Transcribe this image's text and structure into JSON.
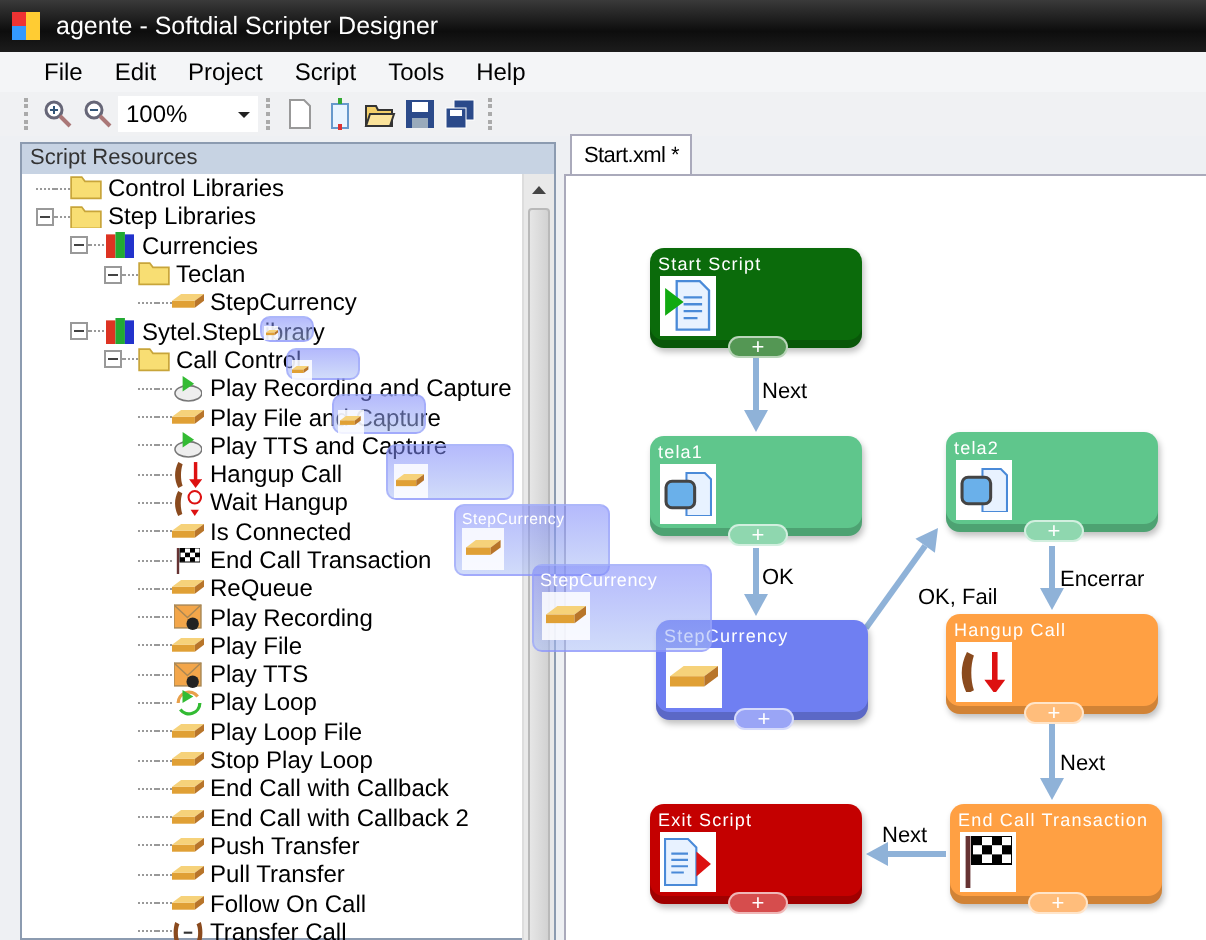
{
  "window": {
    "title": "agente - Softdial Scripter Designer"
  },
  "menu": [
    "File",
    "Edit",
    "Project",
    "Script",
    "Tools",
    "Help"
  ],
  "toolbar": {
    "zoom_value": "100%"
  },
  "resources": {
    "title": "Script Resources",
    "tree": [
      {
        "label": "Control Libraries",
        "kind": "folder"
      },
      {
        "label": "Step Libraries",
        "kind": "folder",
        "expanded": true,
        "children": [
          {
            "label": "Currencies",
            "kind": "library",
            "expanded": true,
            "children": [
              {
                "label": "Teclan",
                "kind": "folder",
                "expanded": true,
                "children": [
                  {
                    "label": "StepCurrency",
                    "kind": "gold-bar"
                  }
                ]
              }
            ]
          },
          {
            "label": "Sytel.StepLibrary",
            "kind": "library",
            "expanded": true,
            "children": [
              {
                "label": "Call Control",
                "kind": "folder",
                "expanded": true,
                "children": [
                  {
                    "label": "Play Recording and Capture",
                    "kind": "play-capture"
                  },
                  {
                    "label": "Play File and Capture",
                    "kind": "gold-bar"
                  },
                  {
                    "label": "Play TTS and Capture",
                    "kind": "play-capture"
                  },
                  {
                    "label": "Hangup Call",
                    "kind": "hangup"
                  },
                  {
                    "label": "Wait Hangup",
                    "kind": "wait-hangup"
                  },
                  {
                    "label": "Is Connected",
                    "kind": "gold-bar"
                  },
                  {
                    "label": "End Call Transaction",
                    "kind": "flag"
                  },
                  {
                    "label": "ReQueue",
                    "kind": "gold-bar"
                  },
                  {
                    "label": "Play Recording",
                    "kind": "recording"
                  },
                  {
                    "label": "Play File",
                    "kind": "gold-bar"
                  },
                  {
                    "label": "Play TTS",
                    "kind": "recording"
                  },
                  {
                    "label": "Play Loop",
                    "kind": "loop"
                  },
                  {
                    "label": "Play Loop File",
                    "kind": "gold-bar"
                  },
                  {
                    "label": "Stop Play Loop",
                    "kind": "gold-bar"
                  },
                  {
                    "label": "End Call with Callback",
                    "kind": "gold-bar"
                  },
                  {
                    "label": "End Call with Callback 2",
                    "kind": "gold-bar"
                  },
                  {
                    "label": "Push Transfer",
                    "kind": "gold-bar"
                  },
                  {
                    "label": "Pull Transfer",
                    "kind": "gold-bar"
                  },
                  {
                    "label": "Follow On Call",
                    "kind": "gold-bar"
                  },
                  {
                    "label": "Transfer Call",
                    "kind": "transfer"
                  }
                ]
              }
            ]
          }
        ]
      }
    ]
  },
  "tabs": [
    {
      "label": "Start.xml *",
      "selected": true
    }
  ],
  "nodes": [
    {
      "label": "Start Script",
      "kind": "start",
      "color": "#0b6b0b",
      "handle": "+"
    },
    {
      "label": "tela1",
      "kind": "screen",
      "color": "#5fc68c",
      "handle": "+"
    },
    {
      "label": "tela2",
      "kind": "screen",
      "color": "#5fc68c",
      "handle": "+"
    },
    {
      "label": "StepCurrency",
      "kind": "gold-bar",
      "color": "#6f7ff2",
      "handle": "+"
    },
    {
      "label": "Hangup Call",
      "kind": "hangup",
      "color": "#ffa043",
      "handle": "+"
    },
    {
      "label": "Exit Script",
      "kind": "exit",
      "color": "#c40000",
      "handle": "+"
    },
    {
      "label": "End Call Transaction",
      "kind": "flag",
      "color": "#ffa043",
      "handle": "+"
    }
  ],
  "edges": [
    {
      "label": "Next"
    },
    {
      "label": "OK"
    },
    {
      "label": "OK, Fail"
    },
    {
      "label": "Encerrar"
    },
    {
      "label": "Next"
    },
    {
      "label": "Next"
    }
  ],
  "drag_ghosts": [
    {
      "kind": "step"
    },
    {
      "kind": "step"
    },
    {
      "kind": "step"
    },
    {
      "kind": "step"
    },
    {
      "kind": "step",
      "label": "StepCurrency"
    },
    {
      "kind": "step",
      "label": "StepCurrency"
    }
  ]
}
